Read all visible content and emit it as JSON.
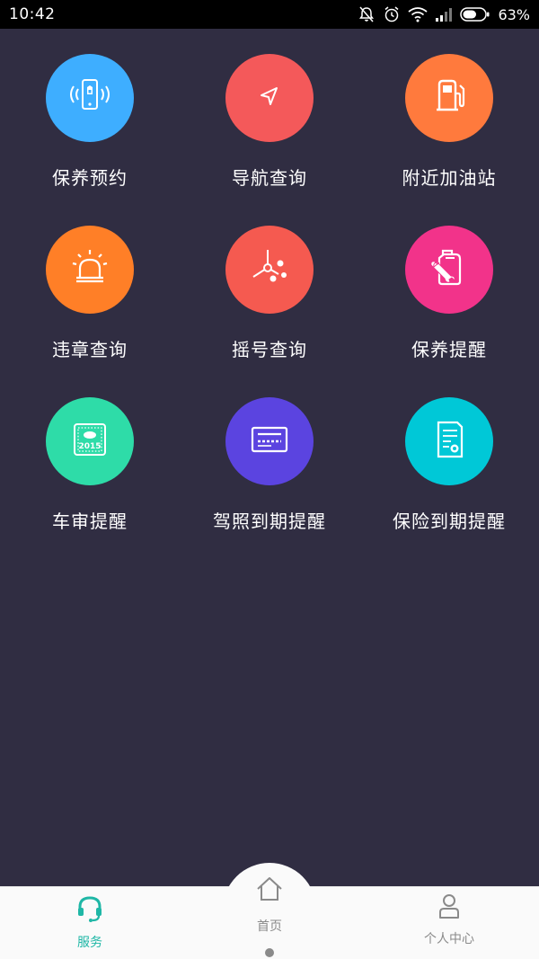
{
  "status_bar": {
    "time": "10:42",
    "battery_percent": "63%",
    "battery_level": 0.63,
    "icons": [
      "muted-bell-icon",
      "alarm-clock-icon",
      "wifi-icon",
      "signal-icon",
      "battery-icon"
    ]
  },
  "services": [
    {
      "label": "保养预约",
      "icon": "phone-signal-icon",
      "color": "#3eaeff"
    },
    {
      "label": "导航查询",
      "icon": "navigation-arrow-icon",
      "color": "#f4595a"
    },
    {
      "label": "附近加油站",
      "icon": "fuel-pump-icon",
      "color": "#ff7a3d"
    },
    {
      "label": "违章查询",
      "icon": "alarm-light-icon",
      "color": "#ff7f27"
    },
    {
      "label": "摇号查询",
      "icon": "lottery-spin-icon",
      "color": "#f55a50"
    },
    {
      "label": "保养提醒",
      "icon": "oil-can-wrench-icon",
      "color": "#f2338a"
    },
    {
      "label": "车审提醒",
      "icon": "inspection-sticker-icon",
      "color": "#2edca8",
      "badge_text": "2015"
    },
    {
      "label": "驾照到期提醒",
      "icon": "license-card-icon",
      "color": "#5b44e0"
    },
    {
      "label": "保险到期提醒",
      "icon": "insurance-document-icon",
      "color": "#00c8d7"
    }
  ],
  "tab_bar": {
    "service": {
      "label": "服务",
      "icon": "headset-icon",
      "active_color": "#1fb7a6"
    },
    "home": {
      "label": "首页",
      "icon": "home-icon"
    },
    "profile": {
      "label": "个人中心",
      "icon": "person-icon"
    }
  }
}
